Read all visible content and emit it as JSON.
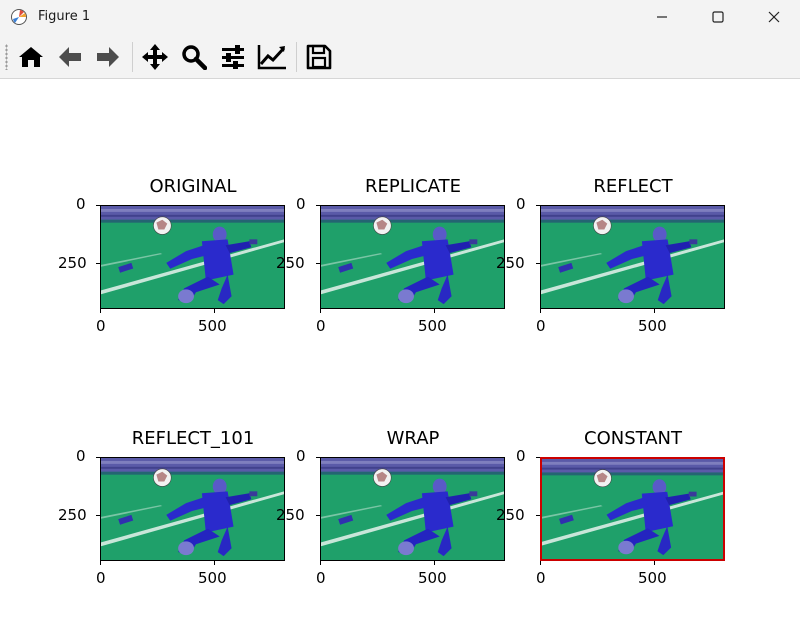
{
  "window": {
    "title": "Figure 1",
    "controls": [
      "minimize",
      "maximize",
      "close"
    ]
  },
  "toolbar": {
    "buttons": [
      {
        "name": "home",
        "icon": "home-icon"
      },
      {
        "name": "back",
        "icon": "arrow-left-icon"
      },
      {
        "name": "forward",
        "icon": "arrow-right-icon"
      },
      {
        "name": "pan",
        "icon": "move-icon"
      },
      {
        "name": "zoom",
        "icon": "search-icon"
      },
      {
        "name": "configure-subplots",
        "icon": "sliders-icon"
      },
      {
        "name": "edit-axis",
        "icon": "line-chart-icon"
      },
      {
        "name": "save",
        "icon": "floppy-disk-icon"
      }
    ]
  },
  "figure": {
    "subplots": [
      {
        "title": "ORIGINAL",
        "yticks": [
          "0",
          "250"
        ],
        "xticks": [
          "0",
          "500"
        ],
        "border_color": "#000000"
      },
      {
        "title": "REPLICATE",
        "yticks": [
          "0",
          "250"
        ],
        "xticks": [
          "0",
          "500"
        ],
        "border_color": "#000000"
      },
      {
        "title": "REFLECT",
        "yticks": [
          "0",
          "250"
        ],
        "xticks": [
          "0",
          "500"
        ],
        "border_color": "#000000"
      },
      {
        "title": "REFLECT_101",
        "yticks": [
          "0",
          "250"
        ],
        "xticks": [
          "0",
          "500"
        ],
        "border_color": "#000000"
      },
      {
        "title": "WRAP",
        "yticks": [
          "0",
          "250"
        ],
        "xticks": [
          "0",
          "500"
        ],
        "border_color": "#000000"
      },
      {
        "title": "CONSTANT",
        "yticks": [
          "0",
          "250"
        ],
        "xticks": [
          "0",
          "500"
        ],
        "border_color": "#cc0000"
      }
    ]
  },
  "colors": {
    "pitch": "#1fa06a",
    "crowd": "#5a5aa8",
    "player_kit": "#2a2acc",
    "constant_border": "#cc0000"
  }
}
